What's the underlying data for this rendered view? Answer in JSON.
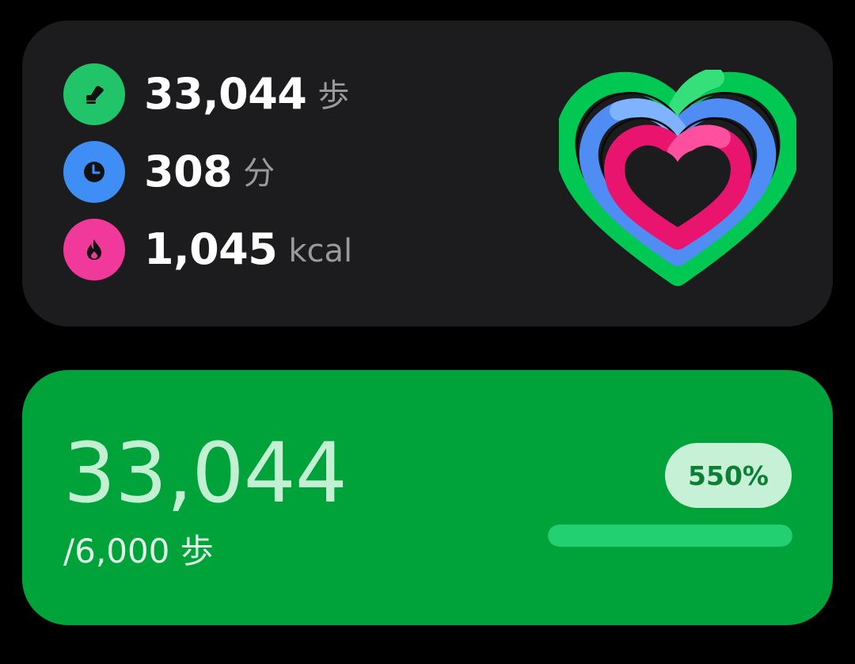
{
  "activity_card": {
    "metrics": [
      {
        "value": "33,044",
        "unit": "歩",
        "icon": "shoe-icon",
        "color": "#21c468"
      },
      {
        "value": "308",
        "unit": "分",
        "icon": "clock-icon",
        "color": "#3e8ef6"
      },
      {
        "value": "1,045",
        "unit": "kcal",
        "icon": "flame-icon",
        "color": "#f0399a"
      }
    ],
    "heart_icon": "activity-heart-rings-icon"
  },
  "steps_card": {
    "count": "33,044",
    "goal": "/6,000 歩",
    "percent": "550%",
    "progress_fraction": 1.0,
    "colors": {
      "background": "#00a23a",
      "badge": "#c6f1d6",
      "bar": "#22d071"
    }
  }
}
